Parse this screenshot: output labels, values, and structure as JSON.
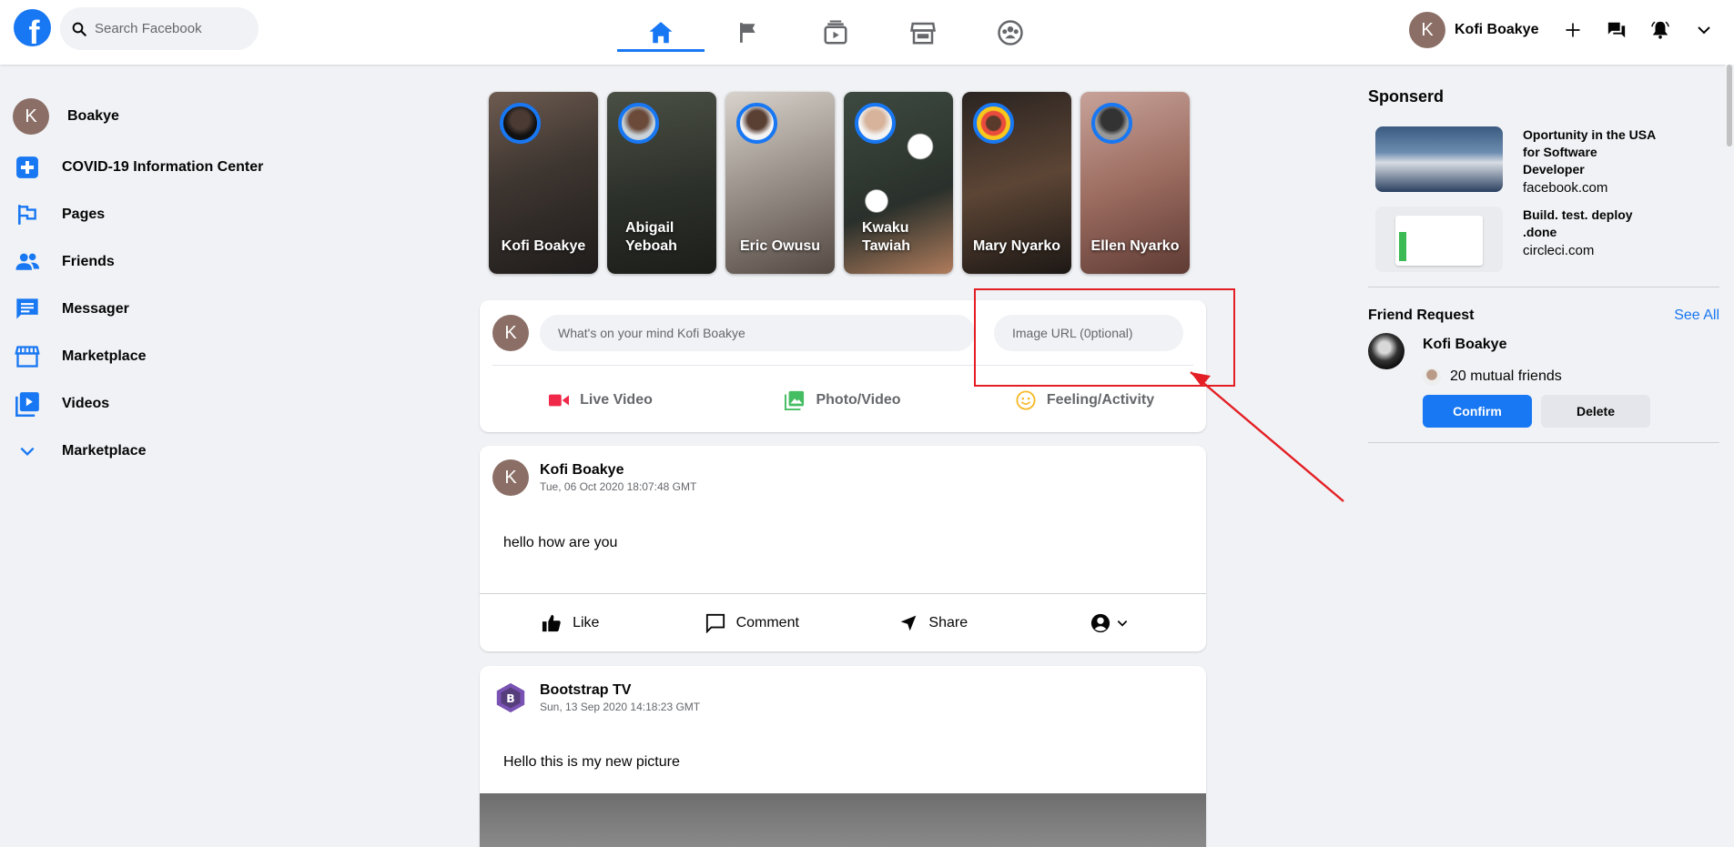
{
  "header": {
    "logo": "f",
    "search_placeholder": "Search Facebook",
    "tabs": [
      {
        "icon": "home-icon",
        "active": true
      },
      {
        "icon": "flag-icon",
        "active": false
      },
      {
        "icon": "watch-icon",
        "active": false
      },
      {
        "icon": "marketplace-icon",
        "active": false
      },
      {
        "icon": "groups-icon",
        "active": false
      }
    ],
    "user_initial": "K",
    "user_name": "Kofi Boakye"
  },
  "sidebar": {
    "user": {
      "initial": "K",
      "name": "Boakye"
    },
    "items": [
      {
        "icon": "covid-plus-icon",
        "label": "COVID-19 Information Center"
      },
      {
        "icon": "pages-flag-icon",
        "label": "Pages"
      },
      {
        "icon": "friends-icon",
        "label": "Friends"
      },
      {
        "icon": "messenger-icon",
        "label": "Messager"
      },
      {
        "icon": "marketplace-icon",
        "label": "Marketplace"
      },
      {
        "icon": "videos-icon",
        "label": "Videos"
      },
      {
        "icon": "chevron-down-icon",
        "label": "Marketplace"
      }
    ]
  },
  "stories": [
    {
      "name": "Kofi Boakye"
    },
    {
      "name": "Abigail Yeboah"
    },
    {
      "name": "Eric Owusu"
    },
    {
      "name": "Kwaku Tawiah"
    },
    {
      "name": "Mary Nyarko"
    },
    {
      "name": "Ellen Nyarko"
    }
  ],
  "composer": {
    "avatar_initial": "K",
    "message_placeholder": "What's on your mind Kofi Boakye",
    "image_url_placeholder": "Image URL (0ptional)",
    "actions": [
      {
        "icon": "live-video-icon",
        "label": "Live Video",
        "color": "#f02849"
      },
      {
        "icon": "photo-video-icon",
        "label": "Photo/Video",
        "color": "#45bd62"
      },
      {
        "icon": "feeling-icon",
        "label": "Feeling/Activity",
        "color": "#f7b928"
      }
    ]
  },
  "posts": [
    {
      "author_initial": "K",
      "author": "Kofi Boakye",
      "time": "Tue, 06 Oct 2020 18:07:48 GMT",
      "text": "hello how are you",
      "actions": {
        "like": "Like",
        "comment": "Comment",
        "share": "Share"
      }
    },
    {
      "author": "Bootstrap TV",
      "time": "Sun, 13 Sep 2020 14:18:23 GMT",
      "text": "Hello this is my new picture"
    }
  ],
  "rightbar": {
    "sponsored_title": "Sponserd",
    "sponsors": [
      {
        "headline": "Oportunity in the USA for Software Developer",
        "url": "facebook.com"
      },
      {
        "headline": "Build. test. deploy .done",
        "url": "circleci.com"
      }
    ],
    "friend_request": {
      "title": "Friend Request",
      "see_all": "See All",
      "name": "Kofi Boakye",
      "mutual": "20 mutual friends",
      "confirm": "Confirm",
      "delete": "Delete"
    }
  },
  "colors": {
    "brand": "#1877f2",
    "annotation": "#e31e24"
  }
}
